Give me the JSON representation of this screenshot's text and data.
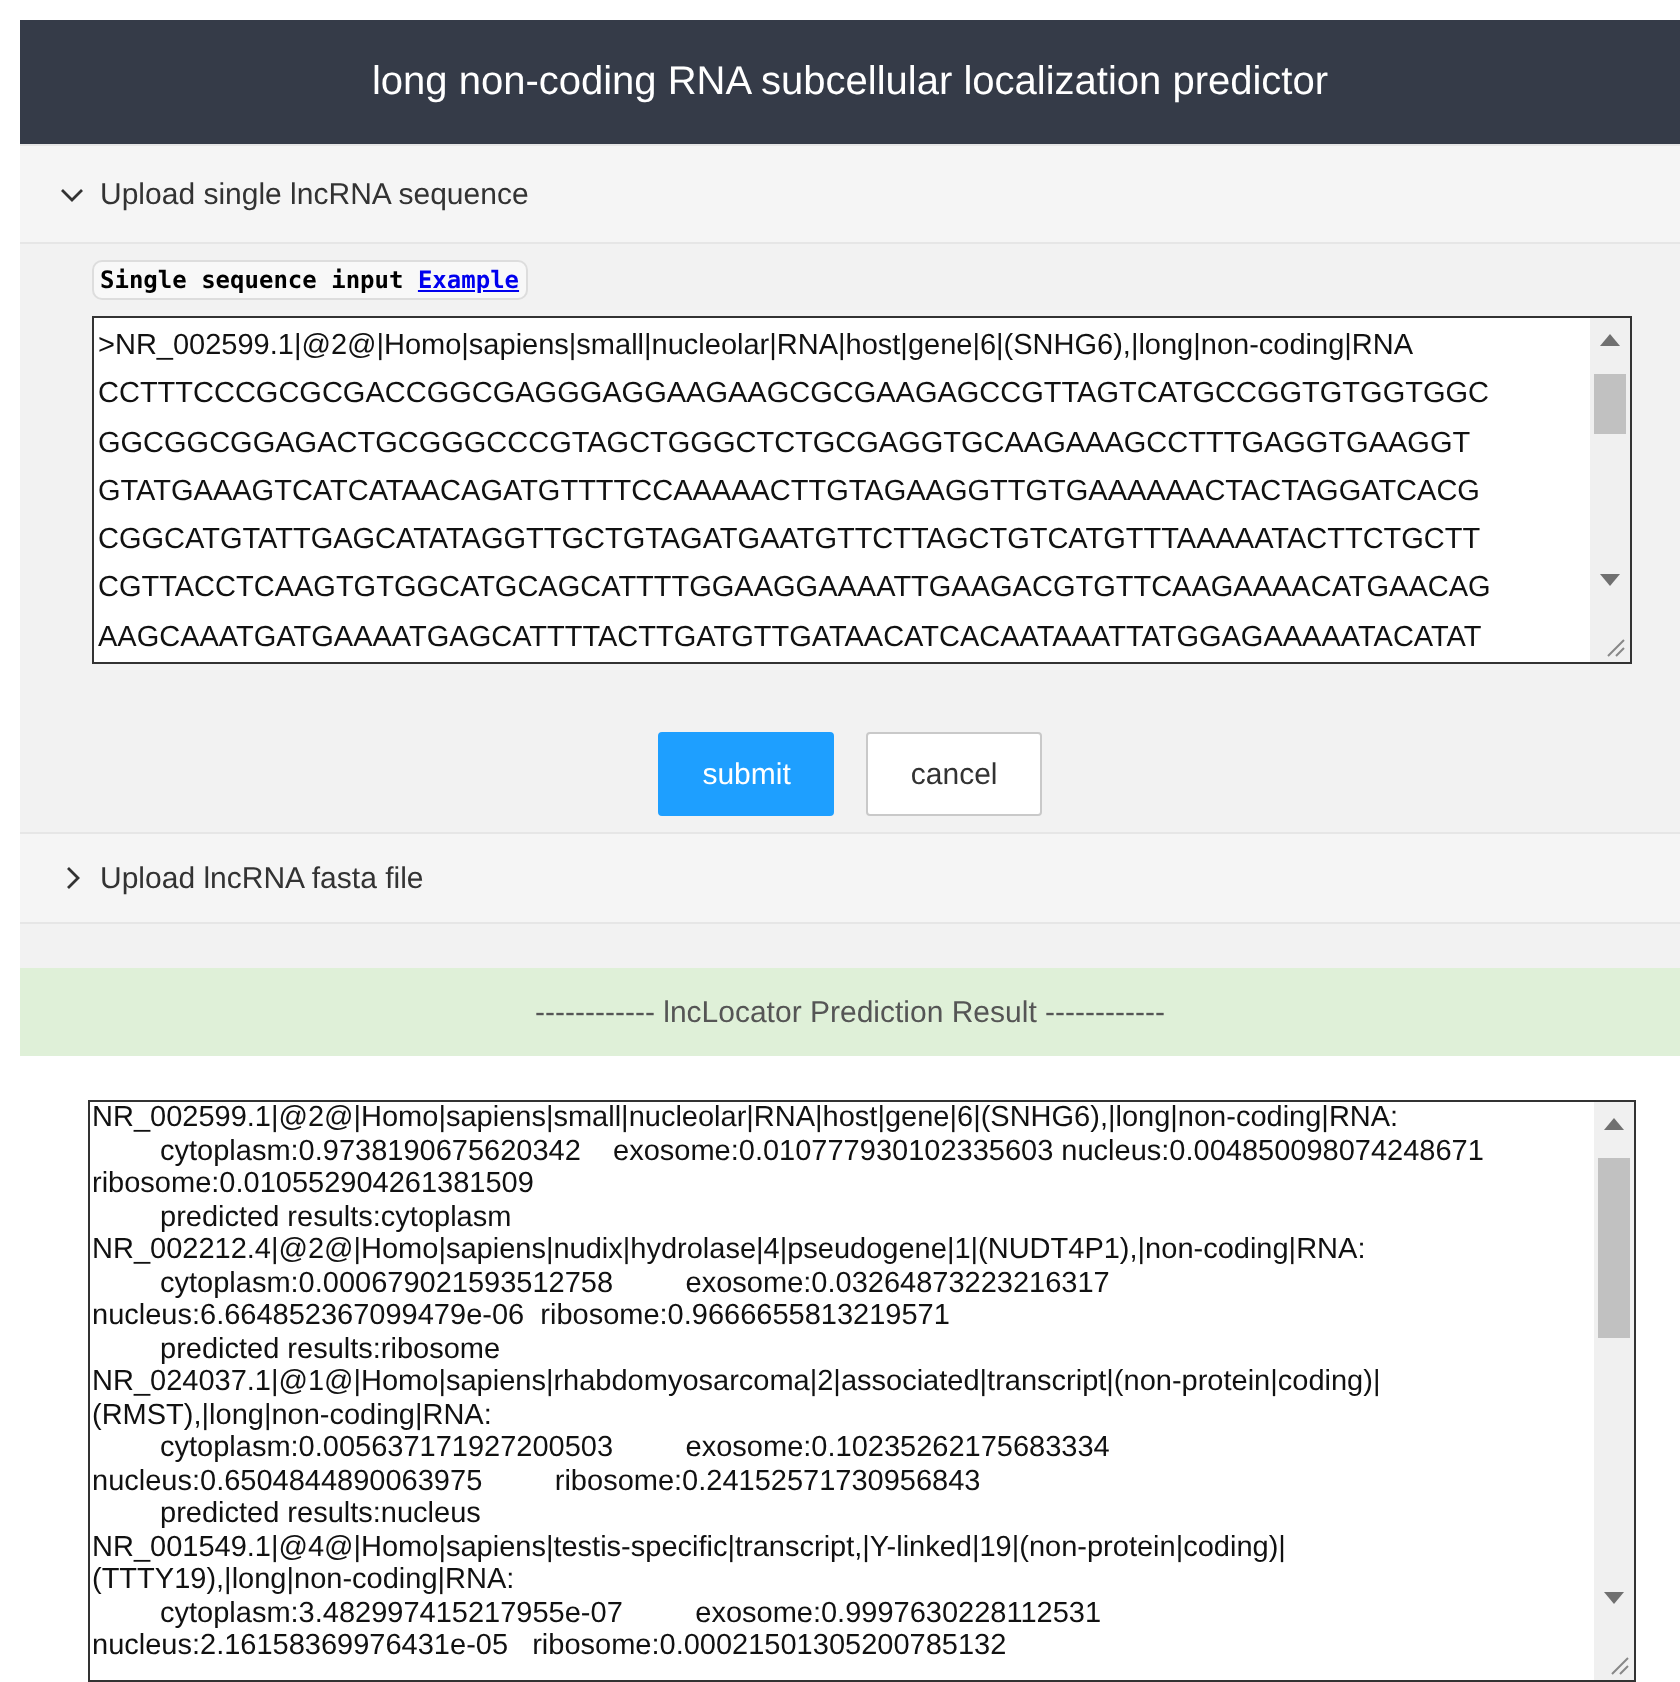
{
  "header": {
    "title": "long non-coding RNA subcellular localization predictor"
  },
  "sections": [
    {
      "title": "Upload single lncRNA sequence",
      "expanded": true
    },
    {
      "title": "Upload lncRNA fasta file",
      "expanded": false
    }
  ],
  "single_input": {
    "label": "Single sequence input",
    "link": "Example",
    "lines": [
      ">NR_002599.1|@2@|Homo|sapiens|small|nucleolar|RNA|host|gene|6|(SNHG6),|long|non-coding|RNA",
      "CCTTTCCCGCGCGACCGGCGAGGGAGGAAGAAGCGCGAAGAGCCGTTAGTCATGCCGGTGTGGTGGC",
      "GGCGGCGGAGACTGCGGGCCCGTAGCTGGGCTCTGCGAGGTGCAAGAAAGCCTTTGAGGTGAAGGT",
      "GTATGAAAGTCATCATAACAGATGTTTTCCAAAAACTTGTAGAAGGTTGTGAAAAAACTACTAGGATCACG",
      "CGGCATGTATTGAGCATATAGGTTGCTGTAGATGAATGTTCTTAGCTGTCATGTTTAAAAATACTTCTGCTT",
      "CGTTACCTCAAGTGTGGCATGCAGCATTTTGGAAGGAAAATTGAAGACGTGTTCAAGAAAACATGAACAG",
      "AAGCAAATGATGAAAATGAGCATTTTACTTGATGTTGATAACATCACAATAAATTATGGAGAAAAATACATAT"
    ]
  },
  "buttons": [
    {
      "label": "submit",
      "kind": "primary"
    },
    {
      "label": "cancel",
      "kind": "default"
    }
  ],
  "result": {
    "title": "------------ lncLocator Prediction Result ------------",
    "lines": [
      {
        "text": "NR_002599.1|@2@|Homo|sapiens|small|nucleolar|RNA|host|gene|6|(SNHG6),|long|non-coding|RNA:",
        "indented": false
      },
      {
        "text": "cytoplasm:0.9738190675620342    exosome:0.010777930102335603 nucleus:0.004850098074248671",
        "indented": true
      },
      {
        "text": "ribosome:0.010552904261381509",
        "indented": false
      },
      {
        "text": "predicted results:cytoplasm",
        "indented": true
      },
      {
        "text": "NR_002212.4|@2@|Homo|sapiens|nudix|hydrolase|4|pseudogene|1|(NUDT4P1),|non-coding|RNA:",
        "indented": false
      },
      {
        "text": "cytoplasm:0.000679021593512758         exosome:0.03264873223216317",
        "indented": true
      },
      {
        "text": "nucleus:6.664852367099479e-06  ribosome:0.9666655813219571",
        "indented": false
      },
      {
        "text": "predicted results:ribosome",
        "indented": true
      },
      {
        "text": "NR_024037.1|@1@|Homo|sapiens|rhabdomyosarcoma|2|associated|transcript|(non-protein|coding)|",
        "indented": false
      },
      {
        "text": "(RMST),|long|non-coding|RNA:",
        "indented": false
      },
      {
        "text": "cytoplasm:0.005637171927200503         exosome:0.10235262175683334",
        "indented": true
      },
      {
        "text": "nucleus:0.6504844890063975         ribosome:0.24152571730956843",
        "indented": false
      },
      {
        "text": "predicted results:nucleus",
        "indented": true
      },
      {
        "text": "NR_001549.1|@4@|Homo|sapiens|testis-specific|transcript,|Y-linked|19|(non-protein|coding)|",
        "indented": false
      },
      {
        "text": "(TTTY19),|long|non-coding|RNA:",
        "indented": false
      },
      {
        "text": "cytoplasm:3.482997415217955e-07         exosome:0.9997630228112531",
        "indented": true
      },
      {
        "text": "nucleus:2.16158369976431e-05   ribosome:0.00021501305200785132",
        "indented": false
      }
    ]
  }
}
